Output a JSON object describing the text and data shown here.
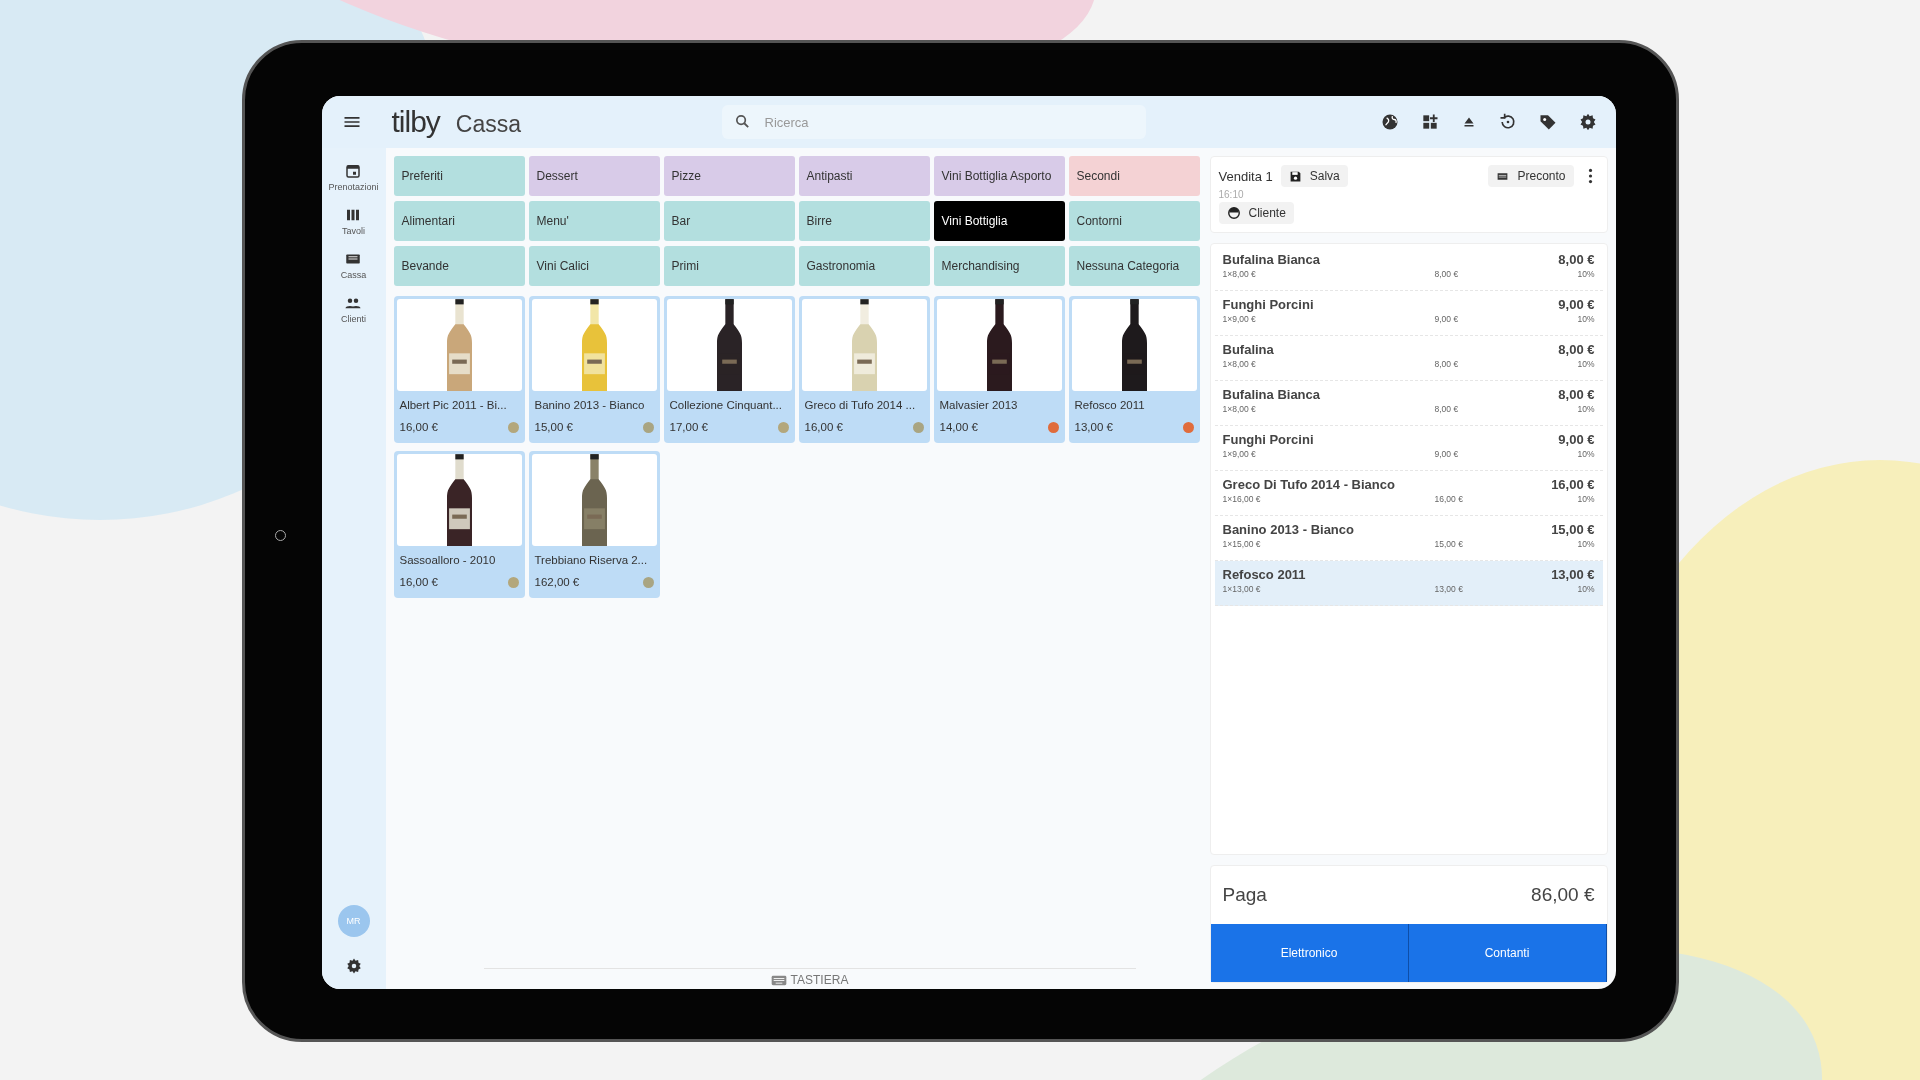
{
  "topbar": {
    "logo": "tilby",
    "title": "Cassa",
    "search": {
      "placeholder": "Ricerca"
    }
  },
  "sidebar": {
    "items": [
      {
        "label": "Prenotazioni",
        "kind": "calendar"
      },
      {
        "label": "Tavoli",
        "kind": "tables"
      },
      {
        "label": "Cassa",
        "kind": "register"
      },
      {
        "label": "Clienti",
        "kind": "people"
      }
    ],
    "avatar": "MR"
  },
  "categories": [
    {
      "label": "Preferiti",
      "color": "#b3dfdf",
      "selected": false
    },
    {
      "label": "Dessert",
      "color": "#d8cbe8",
      "selected": false
    },
    {
      "label": "Pizze",
      "color": "#d8cbe8",
      "selected": false
    },
    {
      "label": "Antipasti",
      "color": "#d8cbe8",
      "selected": false
    },
    {
      "label": "Vini Bottiglia Asporto",
      "color": "#d8cbe8",
      "selected": false
    },
    {
      "label": "Secondi",
      "color": "#f4d2d4",
      "selected": false
    },
    {
      "label": "Alimentari",
      "color": "#b3dfdf",
      "selected": false
    },
    {
      "label": "Menu'",
      "color": "#b3dfdf",
      "selected": false
    },
    {
      "label": "Bar",
      "color": "#b3dfdf",
      "selected": false
    },
    {
      "label": "Birre",
      "color": "#b3dfdf",
      "selected": false
    },
    {
      "label": "Vini Bottiglia",
      "selected": true
    },
    {
      "label": "Contorni",
      "color": "#b3dfdf",
      "selected": false
    },
    {
      "label": "Bevande",
      "color": "#b3dfdf",
      "selected": false
    },
    {
      "label": "Vini Calici",
      "color": "#b3dfdf",
      "selected": false
    },
    {
      "label": "Primi",
      "color": "#b3dfdf",
      "selected": false
    },
    {
      "label": "Gastronomia",
      "color": "#b3dfdf",
      "selected": false
    },
    {
      "label": "Merchandising",
      "color": "#b3dfdf",
      "selected": false
    },
    {
      "label": "Nessuna Categoria",
      "color": "#b3dfdf",
      "selected": false
    }
  ],
  "products": [
    {
      "name": "Albert Pic 2011 - Bi...",
      "price": "16,00 €",
      "color": "#b3a77c"
    },
    {
      "name": "Banino 2013 - Bianco",
      "price": "15,00 €",
      "color": "#a9a582"
    },
    {
      "name": "Collezione Cinquant...",
      "price": "17,00 €",
      "color": "#b3a77c"
    },
    {
      "name": "Greco di Tufo 2014 ...",
      "price": "16,00 €",
      "color": "#a9a582"
    },
    {
      "name": "Malvasier 2013",
      "price": "14,00 €",
      "color": "#e06c3c"
    },
    {
      "name": "Refosco 2011",
      "price": "13,00 €",
      "color": "#e06c3c"
    },
    {
      "name": "Sassoalloro - 2010",
      "price": "16,00 €",
      "color": "#b3a77c"
    },
    {
      "name": "Trebbiano Riserva 2...",
      "price": "162,00 €",
      "color": "#a9a582"
    }
  ],
  "keyboard": "TASTIERA",
  "sale": {
    "title": "Vendita 1",
    "save": "Salva",
    "time": "16:10",
    "customer": "Cliente",
    "precheck": "Preconto"
  },
  "lines": [
    {
      "name": "Bufalina Bianca",
      "qty": "1×8,00 €",
      "unit": "8,00 €",
      "total": "8,00 €",
      "vat": "10%",
      "selected": false
    },
    {
      "name": "Funghi Porcini",
      "qty": "1×9,00 €",
      "unit": "9,00 €",
      "total": "9,00 €",
      "vat": "10%",
      "selected": false
    },
    {
      "name": "Bufalina",
      "qty": "1×8,00 €",
      "unit": "8,00 €",
      "total": "8,00 €",
      "vat": "10%",
      "selected": false
    },
    {
      "name": "Bufalina Bianca",
      "qty": "1×8,00 €",
      "unit": "8,00 €",
      "total": "8,00 €",
      "vat": "10%",
      "selected": false
    },
    {
      "name": "Funghi Porcini",
      "qty": "1×9,00 €",
      "unit": "9,00 €",
      "total": "9,00 €",
      "vat": "10%",
      "selected": false
    },
    {
      "name": "Greco Di Tufo 2014 - Bianco",
      "qty": "1×16,00 €",
      "unit": "16,00 €",
      "total": "16,00 €",
      "vat": "10%",
      "selected": false
    },
    {
      "name": "Banino 2013 - Bianco",
      "qty": "1×15,00 €",
      "unit": "15,00 €",
      "total": "15,00 €",
      "vat": "10%",
      "selected": false
    },
    {
      "name": "Refosco 2011",
      "qty": "1×13,00 €",
      "unit": "13,00 €",
      "total": "13,00 €",
      "vat": "10%",
      "selected": true
    }
  ],
  "pay": {
    "label": "Paga",
    "amount": "86,00 €",
    "buttons": [
      "Elettronico",
      "Contanti"
    ]
  }
}
